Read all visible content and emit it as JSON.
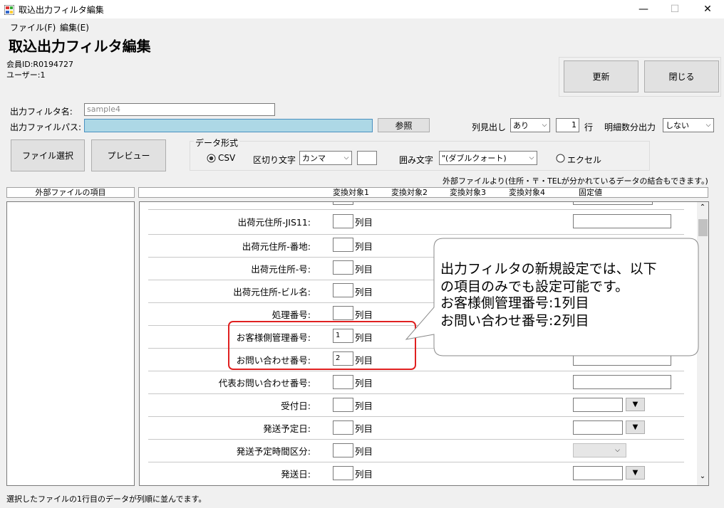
{
  "window": {
    "title": "取込出力フィルタ編集",
    "minimize": "—",
    "maximize": "☐",
    "close": "✕"
  },
  "menu": {
    "file": "ファイル(F)",
    "edit": "編集(E)"
  },
  "heading": "取込出力フィルタ編集",
  "member_id": "会員ID:R0194727",
  "user": "ユーザー:1",
  "buttons": {
    "update": "更新",
    "close": "閉じる",
    "file_select": "ファイル選択",
    "preview": "プレビュー",
    "browse": "参照"
  },
  "filter_name": {
    "label": "出力フィルタ名:",
    "value": "sample4"
  },
  "file_path": {
    "label": "出力ファイルパス:",
    "value": ""
  },
  "header_row": {
    "label": "列見出し",
    "value": "あり",
    "count": "1",
    "unit": "行"
  },
  "detail_output": {
    "label": "明細数分出力",
    "value": "しない"
  },
  "data_format": {
    "group_label": "データ形式",
    "csv_label": "CSV",
    "delimiter_label": "区切り文字",
    "delimiter_value": "カンマ",
    "enclosure_label": "囲み文字",
    "enclosure_value": "\"(ダブルクォート)",
    "excel_label": "エクセル"
  },
  "note_external": "外部ファイルより(住所・〒・TELが分かれているデータの結合もできます。)",
  "left_header": "外部ファイルの項目",
  "columns": [
    "変換対象1",
    "変換対象2",
    "変換対象3",
    "変換対象4",
    "固定値"
  ],
  "unit_label": "列目",
  "rows": [
    {
      "label": "出荷元住所-JIS11:",
      "value": ""
    },
    {
      "label": "出荷元住所-番地:",
      "value": ""
    },
    {
      "label": "出荷元住所-号:",
      "value": ""
    },
    {
      "label": "出荷元住所-ビル名:",
      "value": ""
    },
    {
      "label": "処理番号:",
      "value": ""
    },
    {
      "label": "お客様側管理番号:",
      "value": "1"
    },
    {
      "label": "お問い合わせ番号:",
      "value": "2"
    },
    {
      "label": "代表お問い合わせ番号:",
      "value": ""
    },
    {
      "label": "受付日:",
      "value": ""
    },
    {
      "label": "発送予定日:",
      "value": ""
    },
    {
      "label": "発送予定時間区分:",
      "value": ""
    },
    {
      "label": "発送日:",
      "value": ""
    }
  ],
  "callout": {
    "line1": "出力フィルタの新規設定では、以下",
    "line2": "の項目のみでも設定可能です。",
    "line3": "お客様側管理番号:1列目",
    "line4": "お問い合わせ番号:2列目"
  },
  "status_bar": "選択したファイルの1行目のデータが列順に並んでます。",
  "colors": {
    "highlight_red": "#e02020",
    "path_field": "#add8e6"
  }
}
